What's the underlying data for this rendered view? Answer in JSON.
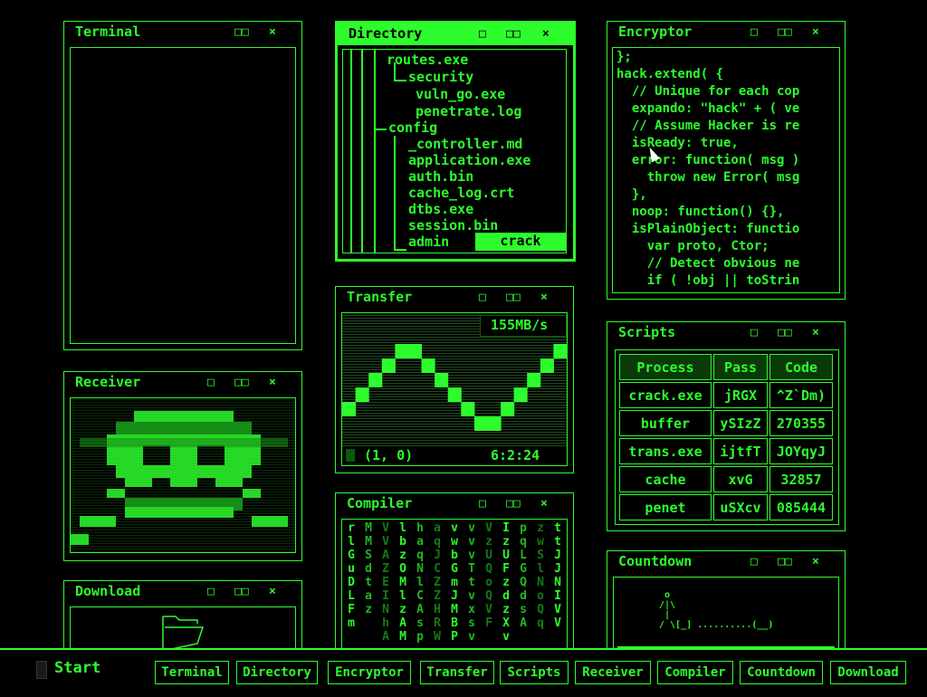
{
  "windows": {
    "terminal": {
      "title": "Terminal",
      "btn_max": "□□",
      "btn_close": "×"
    },
    "directory": {
      "title": "Directory",
      "btn_min": "□",
      "btn_max": "□□",
      "btn_close": "×",
      "tree": [
        "routes.exe",
        "security",
        "vuln_go.exe",
        "penetrate.log",
        "config",
        "_controller.md",
        "application.exe",
        "auth.bin",
        "cache_log.crt",
        "dtbs.exe",
        "session.bin",
        "admin"
      ],
      "crack_label": "crack"
    },
    "encryptor": {
      "title": "Encryptor",
      "btn_min": "□",
      "btn_max": "□□",
      "btn_close": "×",
      "code": [
        "};",
        "hack.extend( {",
        "  // Unique for each cop",
        "  expando: \"hack\" + ( ve",
        "  // Assume Hacker is re",
        "  isReady: true,",
        "  error: function( msg )",
        "    throw new Error( msg",
        "  },",
        "  noop: function() {},",
        "  isPlainObject: functio",
        "    var proto, Ctor;",
        "    // Detect obvious ne",
        "    if ( !obj || toStrin"
      ]
    },
    "receiver": {
      "title": "Receiver",
      "btn_min": "□",
      "btn_max": "□□",
      "btn_close": "×"
    },
    "transfer": {
      "title": "Transfer",
      "btn_min": "□",
      "btn_max": "□□",
      "btn_close": "×",
      "rate": "155MB/s",
      "coords": "(1, 0)",
      "time": "6:2:24",
      "levels": [
        3,
        4,
        5,
        6,
        7,
        7,
        6,
        5,
        4,
        3,
        2,
        2,
        3,
        4,
        5,
        6,
        7
      ]
    },
    "scripts": {
      "title": "Scripts",
      "btn_min": "□",
      "btn_max": "□□",
      "btn_close": "×",
      "headers": [
        "Process",
        "Pass",
        "Code"
      ],
      "rows": [
        [
          "crack.exe",
          "jRGX",
          "^Z`Dm)"
        ],
        [
          "buffer",
          "ySIzZ",
          "270355"
        ],
        [
          "trans.exe",
          "ijtfT",
          "JOYqyJ"
        ],
        [
          "cache",
          "xvG",
          "32857"
        ],
        [
          "penet",
          "uSXcv",
          "085444"
        ]
      ]
    },
    "compiler": {
      "title": "Compiler",
      "btn_min": "□",
      "btn_max": "□□",
      "btn_close": "×",
      "columns": [
        "rlGuDLFm",
        "MMSdtaz",
        "VVAZEINhA",
        "lbzOMlzAM",
        "haqNlCAsp",
        "aqJCZZHRW",
        "vwbGmJMBP",
        "vvvTtvxsv",
        "VzUQoQVF",
        "IzUFzdzXv",
        "pqLGQdsA",
        "zwSlNoQq",
        "ttJJNIVV"
      ]
    },
    "countdown": {
      "title": "Countdown",
      "btn_min": "□",
      "btn_max": "□□",
      "btn_close": "×",
      "art": " o\n/|\\\n |\n/ \\[_] ..........(__)"
    },
    "download": {
      "title": "Download",
      "btn_min": "□",
      "btn_max": "□□",
      "btn_close": "×"
    }
  },
  "taskbar": {
    "start": "Start",
    "buttons": [
      "Terminal",
      "Directory",
      "Encryptor",
      "Transfer",
      "Scripts",
      "Receiver",
      "Compiler",
      "Countdown",
      "Download"
    ]
  },
  "colors": {
    "accent": "#2dfc2d",
    "background": "#000000",
    "dim": "#0a5a0a"
  }
}
